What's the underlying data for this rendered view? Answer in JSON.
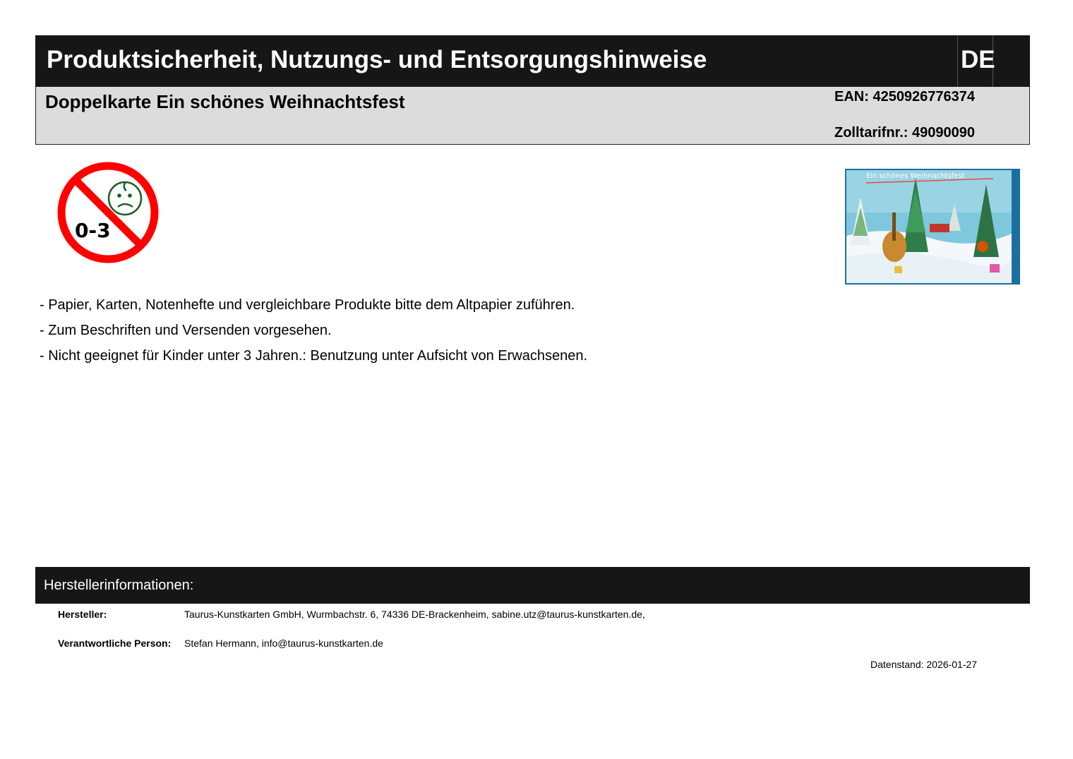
{
  "header": {
    "title": "Produktsicherheit, Nutzungs- und Entsorgungshinweise",
    "language": "DE"
  },
  "product": {
    "name": "Doppelkarte Ein schönes Weihnachtsfest",
    "ean": "EAN: 4250926776374",
    "zolltarif": "Zolltarifnr.: 49090090"
  },
  "age_warning": {
    "icon": "not-for-children-0-3-icon",
    "label": "0-3",
    "colors": {
      "ring": "#ff0000",
      "face": "#1b5e20"
    }
  },
  "card_image": {
    "caption": "Ein schönes Weihnachtsfest"
  },
  "notes": [
    "- Papier, Karten, Notenhefte und vergleichbare Produkte bitte dem Altpapier zuführen.",
    "- Zum Beschriften und Versenden vorgesehen.",
    "- Nicht geeignet für Kinder unter 3 Jahren.: Benutzung unter Aufsicht von Erwachsenen."
  ],
  "manufacturer": {
    "section_title": "Herstellerinformationen:",
    "hersteller_label": "Hersteller:",
    "hersteller_value": "Taurus-Kunstkarten GmbH, Wurmbachstr. 6, 74336 DE-Brackenheim, sabine.utz@taurus-kunstkarten.de,",
    "person_label": "Verantwortliche Person:",
    "person_value": "Stefan Hermann, info@taurus-kunstkarten.de"
  },
  "datenstand": "Datenstand: 2026-01-27"
}
